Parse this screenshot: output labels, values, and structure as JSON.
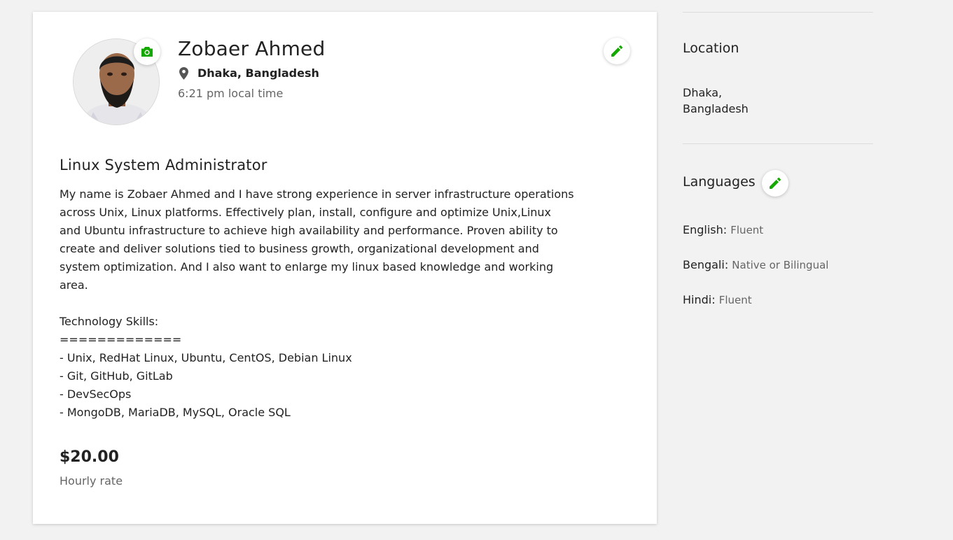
{
  "profile": {
    "name": "Zobaer Ahmed",
    "location": "Dhaka, Bangladesh",
    "local_time": "6:21 pm local time",
    "title": "Linux System Administrator",
    "overview": "My name is Zobaer Ahmed and I have strong experience in server infrastructure operations\nacross Unix, Linux platforms. Effectively plan, install, configure and optimize Unix,Linux\nand Ubuntu infrastructure to achieve high availability and performance. Proven ability to\ncreate and deliver solutions tied to business growth, organizational development and\nsystem optimization. And I also want to enlarge my linux based knowledge and working\narea.\n\nTechnology Skills:\n=============\n- Unix, RedHat Linux, Ubuntu, CentOS, Debian Linux\n- Git, GitHub, GitLab\n- DevSecOps\n- MongoDB, MariaDB, MySQL, Oracle SQL",
    "hourly_rate": "$20.00",
    "hourly_rate_label": "Hourly rate"
  },
  "sidebar": {
    "location_heading": "Location",
    "location_value": "Dhaka,\nBangladesh",
    "languages_heading": "Languages",
    "languages": [
      {
        "name": "English:",
        "proficiency": "Fluent"
      },
      {
        "name": "Bengali:",
        "proficiency": "Native or Bilingual"
      },
      {
        "name": "Hindi:",
        "proficiency": "Fluent"
      }
    ]
  },
  "icons": {
    "camera": "camera-icon",
    "edit": "pencil-icon",
    "location": "map-pin-icon"
  },
  "colors": {
    "accent_green": "#14a800",
    "page_bg": "#f2f2f2",
    "muted_text": "#656565"
  }
}
